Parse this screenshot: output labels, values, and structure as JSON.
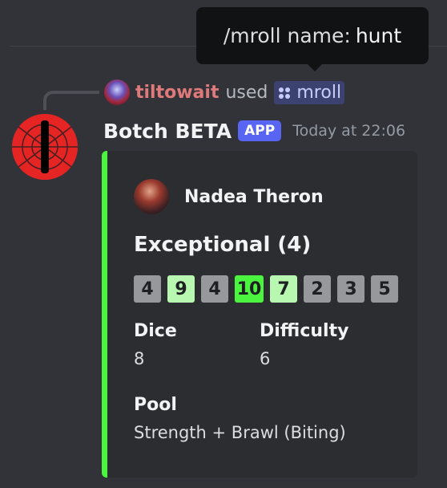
{
  "tooltip": {
    "label": "/mroll name:",
    "value": "hunt"
  },
  "reply": {
    "user": "tiltowait",
    "verb": "used",
    "command": "mroll"
  },
  "message": {
    "author": "Botch BETA",
    "tag": "APP",
    "timestamp": "Today at 22:06"
  },
  "embed": {
    "accent_color": "#4bf53f",
    "author": "Nadea Theron",
    "title": "Exceptional (4)",
    "dice": [
      {
        "value": "4",
        "color": "#97989c"
      },
      {
        "value": "9",
        "color": "#b8f7b0"
      },
      {
        "value": "4",
        "color": "#97989c"
      },
      {
        "value": "10",
        "color": "#4bf53f"
      },
      {
        "value": "7",
        "color": "#b8f7b0"
      },
      {
        "value": "2",
        "color": "#97989c"
      },
      {
        "value": "3",
        "color": "#97989c"
      },
      {
        "value": "5",
        "color": "#97989c"
      }
    ],
    "fields": {
      "dice": {
        "name": "Dice",
        "value": "8"
      },
      "difficulty": {
        "name": "Difficulty",
        "value": "6"
      },
      "pool": {
        "name": "Pool",
        "value": "Strength + Brawl (Biting)"
      }
    }
  },
  "icons": {
    "command": "slash-command-icon",
    "bot_avatar": "eye-avatar"
  }
}
